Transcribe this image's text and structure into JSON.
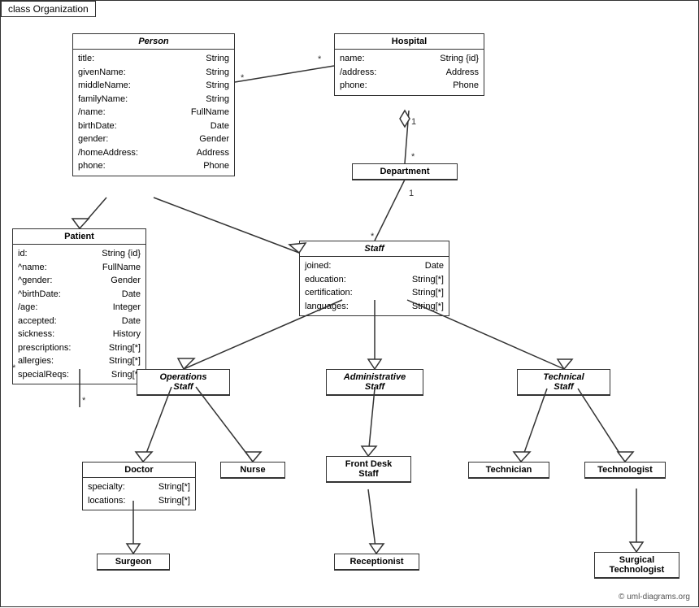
{
  "diagram": {
    "frame_label": "class Organization",
    "copyright": "© uml-diagrams.org",
    "classes": {
      "person": {
        "title": "Person",
        "italic": true,
        "attrs": [
          {
            "name": "title:",
            "type": "String"
          },
          {
            "name": "givenName:",
            "type": "String"
          },
          {
            "name": "middleName:",
            "type": "String"
          },
          {
            "name": "familyName:",
            "type": "String"
          },
          {
            "name": "/name:",
            "type": "FullName"
          },
          {
            "name": "birthDate:",
            "type": "Date"
          },
          {
            "name": "gender:",
            "type": "Gender"
          },
          {
            "name": "/homeAddress:",
            "type": "Address"
          },
          {
            "name": "phone:",
            "type": "Phone"
          }
        ]
      },
      "hospital": {
        "title": "Hospital",
        "italic": false,
        "attrs": [
          {
            "name": "name:",
            "type": "String {id}"
          },
          {
            "name": "/address:",
            "type": "Address"
          },
          {
            "name": "phone:",
            "type": "Phone"
          }
        ]
      },
      "department": {
        "title": "Department",
        "italic": false,
        "attrs": []
      },
      "patient": {
        "title": "Patient",
        "italic": false,
        "attrs": [
          {
            "name": "id:",
            "type": "String {id}"
          },
          {
            "name": "^name:",
            "type": "FullName"
          },
          {
            "name": "^gender:",
            "type": "Gender"
          },
          {
            "name": "^birthDate:",
            "type": "Date"
          },
          {
            "name": "/age:",
            "type": "Integer"
          },
          {
            "name": "accepted:",
            "type": "Date"
          },
          {
            "name": "sickness:",
            "type": "History"
          },
          {
            "name": "prescriptions:",
            "type": "String[*]"
          },
          {
            "name": "allergies:",
            "type": "String[*]"
          },
          {
            "name": "specialReqs:",
            "type": "Sring[*]"
          }
        ]
      },
      "staff": {
        "title": "Staff",
        "italic": true,
        "attrs": [
          {
            "name": "joined:",
            "type": "Date"
          },
          {
            "name": "education:",
            "type": "String[*]"
          },
          {
            "name": "certification:",
            "type": "String[*]"
          },
          {
            "name": "languages:",
            "type": "String[*]"
          }
        ]
      },
      "operations_staff": {
        "title": "Operations Staff",
        "italic": true
      },
      "administrative_staff": {
        "title": "Administrative Staff",
        "italic": true
      },
      "technical_staff": {
        "title": "Technical Staff",
        "italic": true
      },
      "doctor": {
        "title": "Doctor",
        "italic": false,
        "attrs": [
          {
            "name": "specialty:",
            "type": "String[*]"
          },
          {
            "name": "locations:",
            "type": "String[*]"
          }
        ]
      },
      "nurse": {
        "title": "Nurse",
        "italic": false
      },
      "front_desk_staff": {
        "title": "Front Desk Staff",
        "italic": false
      },
      "technician": {
        "title": "Technician",
        "italic": false
      },
      "technologist": {
        "title": "Technologist",
        "italic": false
      },
      "surgeon": {
        "title": "Surgeon",
        "italic": false
      },
      "receptionist": {
        "title": "Receptionist",
        "italic": false
      },
      "surgical_technologist": {
        "title": "Surgical Technologist",
        "italic": false
      }
    },
    "multiplicity": {
      "star": "*",
      "one": "1"
    }
  }
}
